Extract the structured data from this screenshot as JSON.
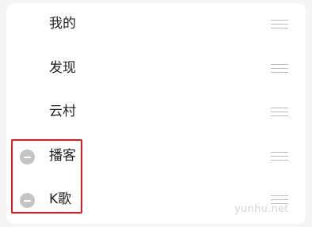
{
  "nav_items": [
    {
      "label": "我的",
      "removable": false
    },
    {
      "label": "发现",
      "removable": false
    },
    {
      "label": "云村",
      "removable": false
    },
    {
      "label": "播客",
      "removable": true
    },
    {
      "label": "K歌",
      "removable": true
    }
  ],
  "watermark": "yunhu.net",
  "colors": {
    "highlight": "#e11b1b",
    "remove_button": "#c4c4c4",
    "drag_handle": "#b9b9b9"
  },
  "icons": {
    "remove": "remove-circle-icon",
    "drag": "drag-handle-icon"
  }
}
